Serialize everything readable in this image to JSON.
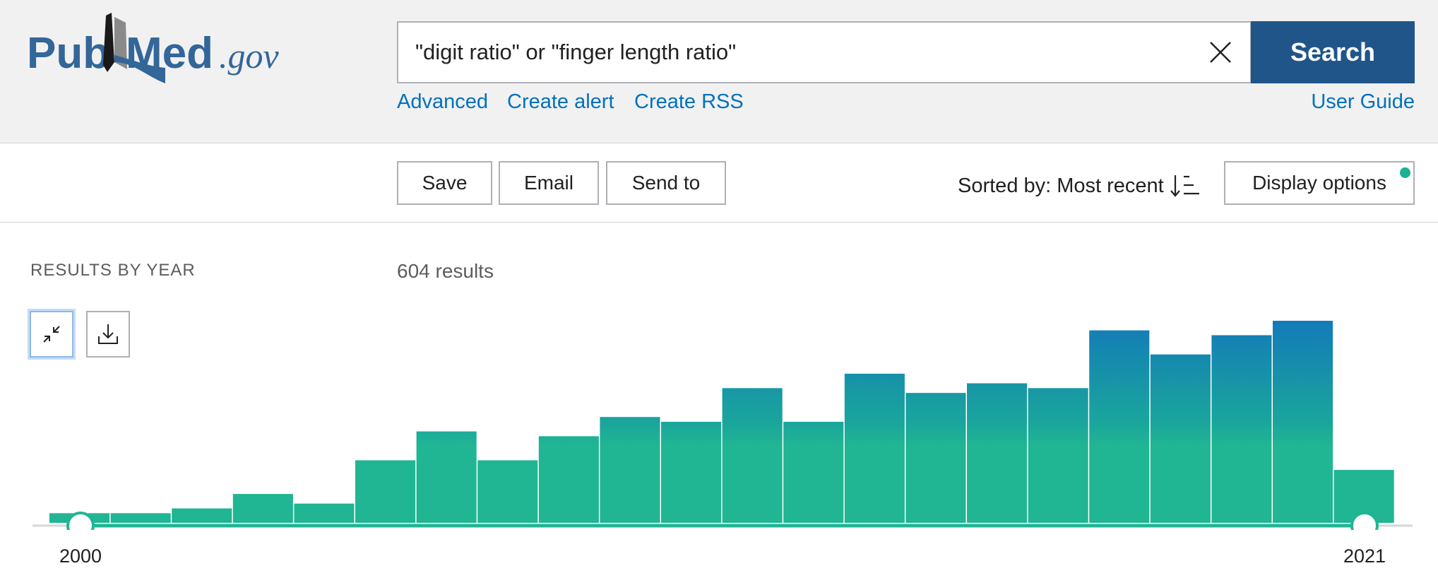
{
  "logo": {
    "pub": "Pub",
    "med": "Med",
    "gov": ".gov"
  },
  "search": {
    "value": "\"digit ratio\" or \"finger length ratio\"",
    "button_label": "Search"
  },
  "header_links": {
    "advanced": "Advanced",
    "create_alert": "Create alert",
    "create_rss": "Create RSS",
    "user_guide": "User Guide"
  },
  "toolbar": {
    "save": "Save",
    "email": "Email",
    "send_to": "Send to",
    "sorted_by": "Sorted by: Most recent",
    "display_options": "Display options"
  },
  "results": {
    "section_title": "RESULTS BY YEAR",
    "count_text": "604 results",
    "min_year_label": "2000",
    "max_year_label": "2021"
  },
  "colors": {
    "brand_blue": "#20558a",
    "link_blue": "#0071bc",
    "teal": "#20b593",
    "bar_top_blue": "#137bb8"
  },
  "chart_data": {
    "type": "bar",
    "categories": [
      2000,
      2001,
      2002,
      2003,
      2004,
      2005,
      2006,
      2007,
      2008,
      2009,
      2010,
      2011,
      2012,
      2013,
      2014,
      2015,
      2016,
      2017,
      2018,
      2019,
      2020,
      2021
    ],
    "values": [
      2,
      2,
      3,
      6,
      4,
      13,
      19,
      13,
      18,
      22,
      21,
      28,
      21,
      31,
      27,
      29,
      28,
      40,
      35,
      39,
      42,
      11
    ],
    "ylim": [
      0,
      42
    ],
    "selected_range": [
      2000,
      2021
    ]
  }
}
